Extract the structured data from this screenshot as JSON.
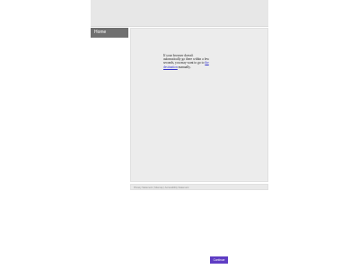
{
  "nav": {
    "home_label": "Home"
  },
  "main": {
    "message_before_link": "If your browser doesn't automatically go there within a few seconds, you may want to go to ",
    "link_text": "the destination",
    "message_after_link": " manually."
  },
  "footer": {
    "text": "Privacy Statement | Sitemap | Accessibility Statement"
  },
  "consent": {
    "button_label": "Continue"
  },
  "colors": {
    "accent": "#5f3dc4",
    "link": "#3333cc",
    "nav_active": "#707070"
  }
}
